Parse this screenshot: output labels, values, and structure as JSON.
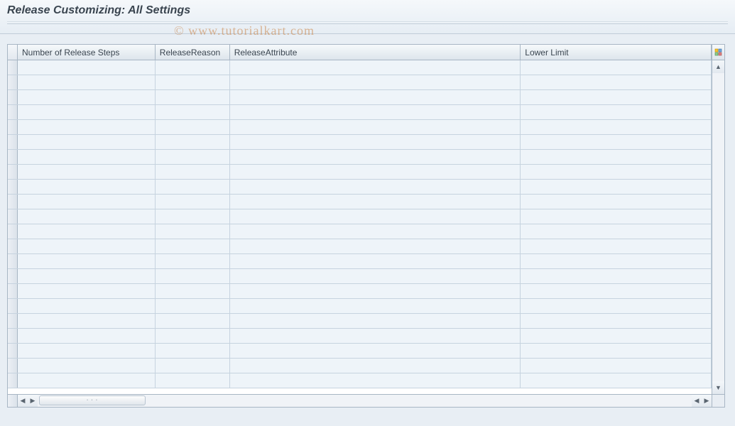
{
  "page": {
    "title": "Release Customizing: All Settings",
    "watermark": "© www.tutorialkart.com"
  },
  "table": {
    "columns": {
      "steps": "Number of Release Steps",
      "reason": "ReleaseReason",
      "attr": "ReleaseAttribute",
      "limit": "Lower Limit"
    },
    "row_count": 22
  }
}
